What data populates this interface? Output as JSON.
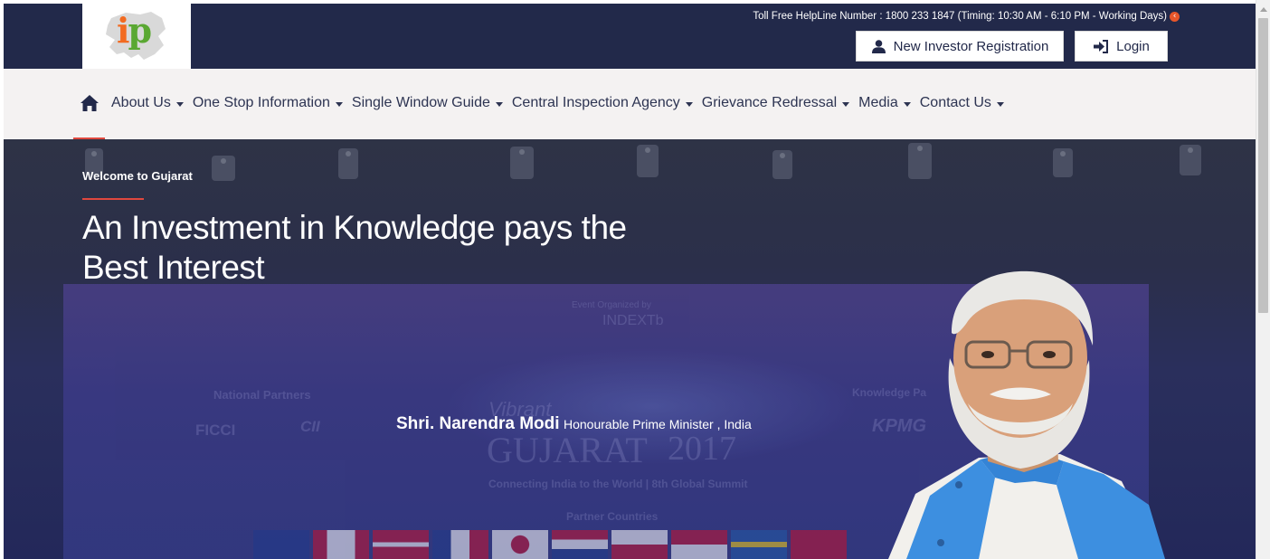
{
  "header": {
    "logo_text_i": "i",
    "logo_text_p": "p",
    "helpline": "Toll Free HelpLine Number : 1800 233 1847 (Timing: 10:30 AM - 6:10 PM - Working Days)",
    "register_label": "New Investor Registration",
    "login_label": "Login"
  },
  "nav": {
    "items": [
      {
        "label": "About Us"
      },
      {
        "label": "One Stop Information"
      },
      {
        "label": "Single Window Guide"
      },
      {
        "label": "Central Inspection Agency"
      },
      {
        "label": "Grievance Redressal"
      },
      {
        "label": "Media"
      },
      {
        "label": "Contact Us"
      }
    ]
  },
  "hero": {
    "eyebrow": "Welcome to Gujarat",
    "headline": "An Investment in Knowledge pays the Best Interest",
    "caption_name": "Shri. Narendra Modi",
    "caption_role": "Honourable Prime Minister , India",
    "background_text": {
      "organized_by": "Event Organized by",
      "indextb": "INDEXTb",
      "national_partners": "National Partners",
      "ficci": "FICCI",
      "cii": "CII",
      "knowledge_partner": "Knowledge Pa",
      "kpmg": "KPMG",
      "vibrant": "Vibrant",
      "gujarat": "GUJARAT",
      "year": "2017",
      "tagline": "Connecting India to the World | 8th Global Summit",
      "partner_countries": "Partner Countries"
    }
  },
  "colors": {
    "header_bg": "#22294a",
    "nav_bg": "#f4f2f2",
    "accent_red": "#e0483e",
    "logo_orange": "#f26b21",
    "logo_green": "#5aa832"
  },
  "icons": {
    "home": "home-icon",
    "user": "user-icon",
    "login": "sign-in-icon",
    "helpline_arrow": "chevron-circle-left-icon"
  }
}
